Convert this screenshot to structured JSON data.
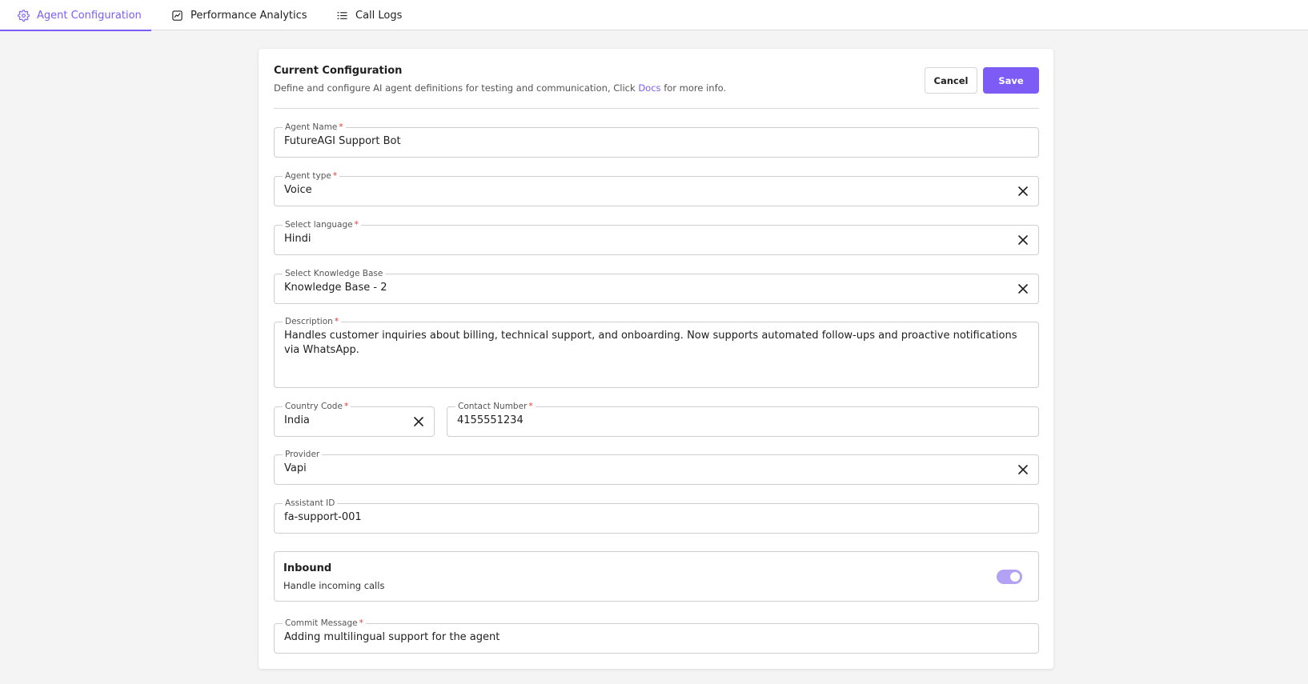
{
  "tabs": [
    {
      "label": "Agent Configuration",
      "icon": "gear-icon",
      "active": true
    },
    {
      "label": "Performance Analytics",
      "icon": "chart-icon",
      "active": false
    },
    {
      "label": "Call Logs",
      "icon": "list-icon",
      "active": false
    }
  ],
  "card": {
    "title": "Current Configuration",
    "subtitle_before": "Define and configure AI agent definitions for testing and communication, Click ",
    "docs_link": "Docs",
    "subtitle_after": " for more info.",
    "cancel_label": "Cancel",
    "save_label": "Save"
  },
  "form": {
    "agent_name": {
      "label": "Agent Name",
      "required": "*",
      "value": "FutureAGI Support Bot"
    },
    "agent_type": {
      "label": "Agent type",
      "required": "*",
      "value": "Voice"
    },
    "language": {
      "label": "Select language",
      "required": "*",
      "value": "Hindi"
    },
    "knowledge_base": {
      "label": "Select Knowledge Base",
      "value": "Knowledge Base - 2"
    },
    "description": {
      "label": "Description",
      "required": "*",
      "value": "Handles customer inquiries about billing, technical support, and onboarding. Now supports automated follow-ups and proactive notifications via WhatsApp."
    },
    "country_code": {
      "label": "Country Code",
      "required": "*",
      "value": "India"
    },
    "contact_number": {
      "label": "Contact Number",
      "required": "*",
      "value": "4155551234"
    },
    "provider": {
      "label": "Provider",
      "value": "Vapi"
    },
    "assistant_id": {
      "label": "Assistant ID",
      "value": "fa-support-001"
    },
    "inbound": {
      "title": "Inbound",
      "subtitle": "Handle incoming calls",
      "enabled": true
    },
    "commit_message": {
      "label": "Commit Message",
      "required": "*",
      "value": "Adding multilingual support for the agent"
    }
  },
  "colors": {
    "accent": "#7c5cf4",
    "required": "#e53935",
    "toggle_on": "#b3a1f4"
  }
}
